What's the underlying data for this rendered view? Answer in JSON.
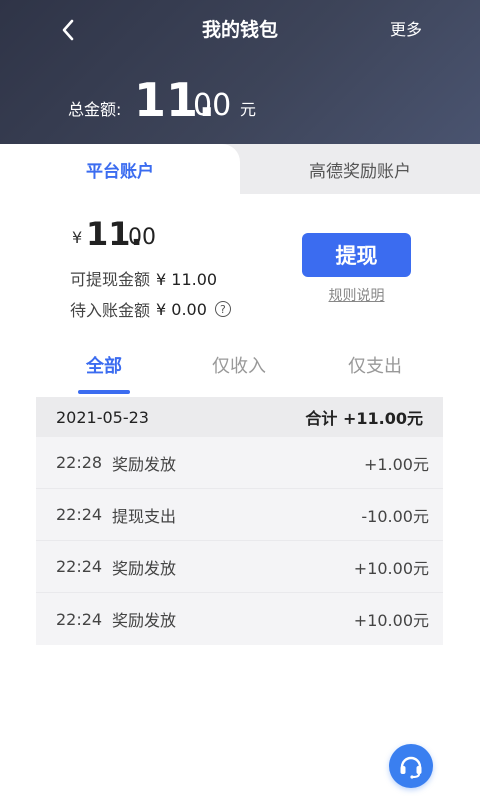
{
  "header": {
    "title": "我的钱包",
    "more_label": "更多",
    "total_label": "总金额:",
    "total_int": "11.",
    "total_dec": "00",
    "total_unit": "元"
  },
  "account_tabs": [
    {
      "label": "平台账户",
      "active": true
    },
    {
      "label": "高德奖励账户",
      "active": false
    }
  ],
  "balance": {
    "currency": "¥",
    "amount_int": "11.",
    "amount_dec": "00",
    "withdrawable_label": "可提现金额",
    "withdrawable_amount": "¥ 11.00",
    "pending_label": "待入账金额",
    "pending_amount": "¥ 0.00",
    "withdraw_button": "提现",
    "rules_link": "规则说明"
  },
  "filter_tabs": [
    {
      "label": "全部",
      "active": true
    },
    {
      "label": "仅收入",
      "active": false
    },
    {
      "label": "仅支出",
      "active": false
    }
  ],
  "transactions": {
    "date": "2021-05-23",
    "sum": "合计 +11.00元",
    "items": [
      {
        "time": "22:28",
        "desc": "奖励发放",
        "amount": "+1.00元"
      },
      {
        "time": "22:24",
        "desc": "提现支出",
        "amount": "-10.00元"
      },
      {
        "time": "22:24",
        "desc": "奖励发放",
        "amount": "+10.00元"
      },
      {
        "time": "22:24",
        "desc": "奖励发放",
        "amount": "+10.00元"
      }
    ]
  },
  "colors": {
    "accent": "#3b6cf0",
    "header_bg": "#3d4459"
  },
  "icons": {
    "back": "chevron-left-icon",
    "help": "question-circle-icon",
    "service": "headset-icon"
  }
}
